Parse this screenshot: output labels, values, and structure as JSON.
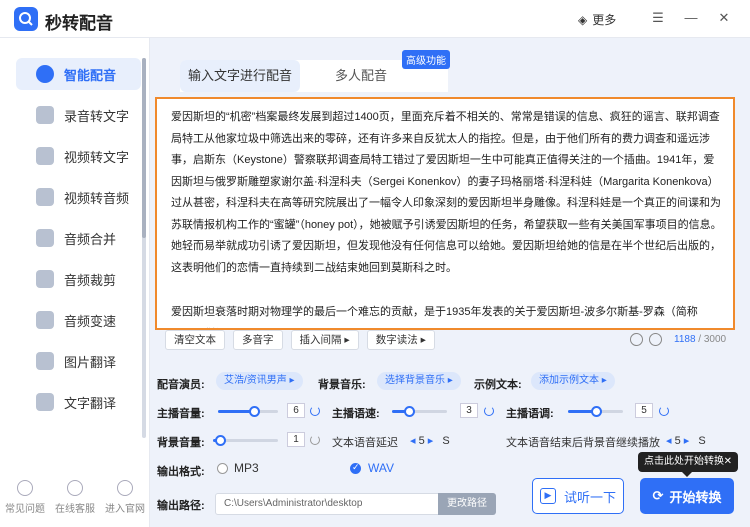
{
  "app": {
    "title": "秒转配音",
    "more_label": "更多"
  },
  "sidebar": {
    "items": [
      {
        "label": "智能配音",
        "icon": "mic-icon",
        "active": true
      },
      {
        "label": "录音转文字",
        "icon": "audio-text-icon"
      },
      {
        "label": "视频转文字",
        "icon": "video-text-icon"
      },
      {
        "label": "视频转音频",
        "icon": "video-audio-icon"
      },
      {
        "label": "音频合并",
        "icon": "merge-icon"
      },
      {
        "label": "音频裁剪",
        "icon": "scissors-icon"
      },
      {
        "label": "音频变速",
        "icon": "speed-icon"
      },
      {
        "label": "图片翻译",
        "icon": "image-translate-icon"
      },
      {
        "label": "文字翻译",
        "icon": "text-translate-icon"
      }
    ],
    "footer": [
      {
        "label": "常见问题",
        "icon": "question-icon"
      },
      {
        "label": "在线客服",
        "icon": "chat-icon"
      },
      {
        "label": "进入官网",
        "icon": "home-icon"
      }
    ]
  },
  "tabs": {
    "active": "输入文字进行配音",
    "other": "多人配音",
    "badge": "高级功能"
  },
  "editor": {
    "paragraph1": "爱因斯坦的“机密”档案最终发展到超过1400页，里面充斥着不相关的、常常是错误的信息、疯狂的谣言、联邦调查局特工从他家垃圾中筛选出来的零碎，还有许多来自反犹太人的指控。但是，由于他们所有的费力调查和遥远涉事，启斯东（Keystone）警察联邦调查局特工错过了爱因斯坦一生中可能真正值得关注的一个插曲。1941年，爱因斯坦与俄罗斯雕塑家谢尔盖·科涅科夫（Sergei Konenkov）的妻子玛格丽塔·科涅科娃（Margarita Konenkova）过从甚密，科涅科夫在高等研究院展出了一幅令人印象深刻的爱因斯坦半身雕像。科涅科娃是一个真正的间谍和为苏联情报机构工作的“蜜罐”（honey pot），她被赋予引诱爱因斯坦的任务，希望获取一些有关美国军事项目的信息。她轻而易举就成功引诱了爱因斯坦，但发现他没有任何信息可以给她。爱因斯坦给她的信是在半个世纪后出版的，这表明他们的恋情一直持续到二战结束她回到莫斯科之时。",
    "paragraph2": "爱因斯坦衰落时期对物理学的最后一个难忘的贡献，是于1935年发表的关于爱因斯坦-波多尔斯基-罗森（简称EPR）佯谬"
  },
  "toolbar": {
    "clear": "清空文本",
    "polyphone": "多音字",
    "pause": "插入间隔",
    "number": "数字读法",
    "count_current": "1188",
    "count_sep": "/",
    "count_max": "3000"
  },
  "settings": {
    "anchor_label": "配音演员:",
    "anchor_value": "艾浩/资讯男声",
    "bgm_label": "背景音乐:",
    "bgm_value": "选择背景音乐",
    "sample_label": "示例文本:",
    "sample_value": "添加示例文本",
    "volume_label": "主播音量:",
    "volume_value": "6",
    "volume_fraction": 0.6,
    "speed_label": "主播语速:",
    "speed_value": "3",
    "speed_fraction": 0.3,
    "pitch_label": "主播语调:",
    "pitch_value": "5",
    "pitch_fraction": 0.5,
    "bg_volume_label": "背景音量:",
    "bg_volume_value": "1",
    "bg_volume_fraction": 0.1,
    "delay_label": "文本语音延迟",
    "delay_value": "5",
    "delay_unit": "S",
    "continue_label": "文本语音结束后背景音继续播放",
    "continue_value": "5",
    "continue_unit": "S",
    "format_label": "输出格式:",
    "format_mp3": "MP3",
    "format_wav": "WAV",
    "format_selected": "WAV",
    "path_label": "输出路径:",
    "path_value": "C:\\Users\\Administrator\\desktop",
    "path_button": "更改路径"
  },
  "actions": {
    "try": "试听一下",
    "start": "开始转换",
    "tooltip": "点击此处开始转换"
  },
  "colors": {
    "accent": "#2f6ff6",
    "highlight_border": "#f08a2c"
  }
}
